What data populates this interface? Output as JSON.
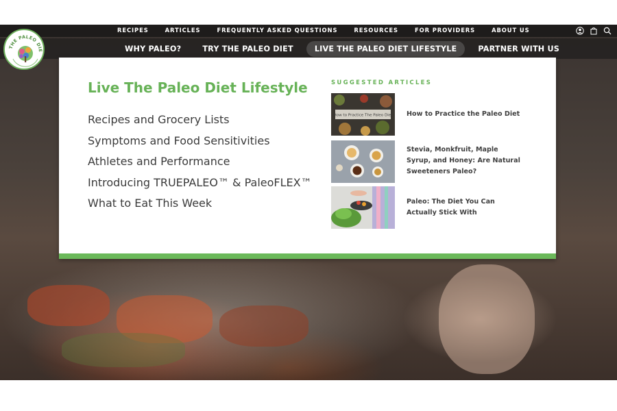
{
  "top_nav": {
    "items": [
      "RECIPES",
      "ARTICLES",
      "FREQUENTLY ASKED QUESTIONS",
      "RESOURCES",
      "FOR PROVIDERS",
      "ABOUT US"
    ]
  },
  "utility_icons": [
    "user-icon",
    "shopping-bag-icon",
    "search-icon"
  ],
  "main_nav": {
    "items": [
      "WHY PALEO?",
      "TRY THE PALEO DIET",
      "LIVE THE PALEO DIET LIFESTYLE",
      "PARTNER WITH US"
    ],
    "active_index": 2
  },
  "logo": {
    "text": "THE PALEO DIET"
  },
  "dropdown": {
    "title": "Live The Paleo Diet Lifestyle",
    "links": [
      "Recipes and Grocery Lists",
      "Symptoms and Food Sensitivities",
      "Athletes and Performance",
      "Introducing TRUEPALEO™ & PaleoFLEX™",
      "What to Eat This Week"
    ],
    "suggested_heading": "SUGGESTED ARTICLES",
    "articles": [
      {
        "title": "How to Practice the Paleo Diet",
        "thumb_text": "How to Practice The Paleo Diet"
      },
      {
        "title": "Stevia, Monkfruit, Maple Syrup, and Honey: Are Natural Sweeteners Paleo?"
      },
      {
        "title": "Paleo: The Diet You Can Actually Stick With"
      }
    ]
  },
  "colors": {
    "accent_green": "#67b257",
    "bar_green": "#6bb95a",
    "nav_text": "#ffffff",
    "body_text": "#3a3a3a"
  }
}
